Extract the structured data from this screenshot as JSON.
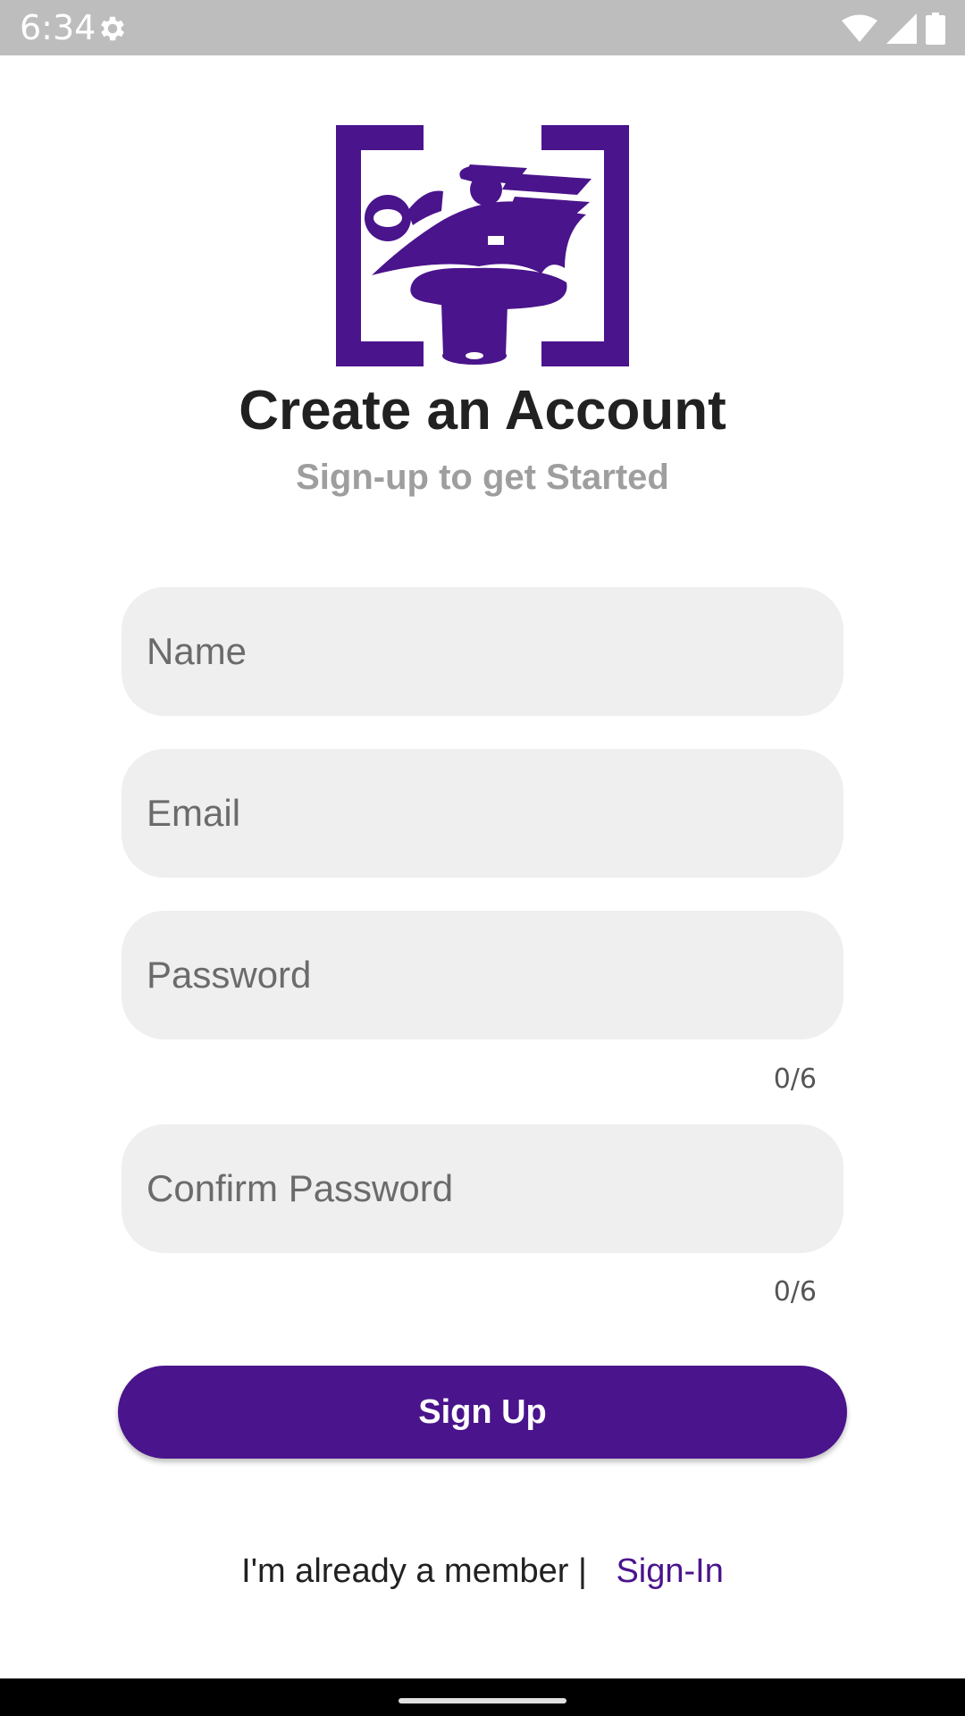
{
  "status_bar": {
    "time": "6:34",
    "icons": [
      "gear-icon",
      "wifi-icon",
      "signal-icon",
      "battery-icon"
    ]
  },
  "logo": {
    "icon": "brand-logo-icon",
    "color": "#4a148c"
  },
  "header": {
    "title": "Create an Account",
    "subtitle": "Sign-up to get Started"
  },
  "form": {
    "name_placeholder": "Name",
    "email_placeholder": "Email",
    "password_placeholder": "Password",
    "password_counter": "0/6",
    "confirm_placeholder": "Confirm Password",
    "confirm_counter": "0/6"
  },
  "actions": {
    "signup_label": "Sign Up"
  },
  "footer": {
    "text": "I'm already a member",
    "separator": "|",
    "link_label": "Sign-In"
  },
  "colors": {
    "primary": "#4a148c",
    "field_bg": "#efefef",
    "status_bar": "#bdbdbd"
  }
}
